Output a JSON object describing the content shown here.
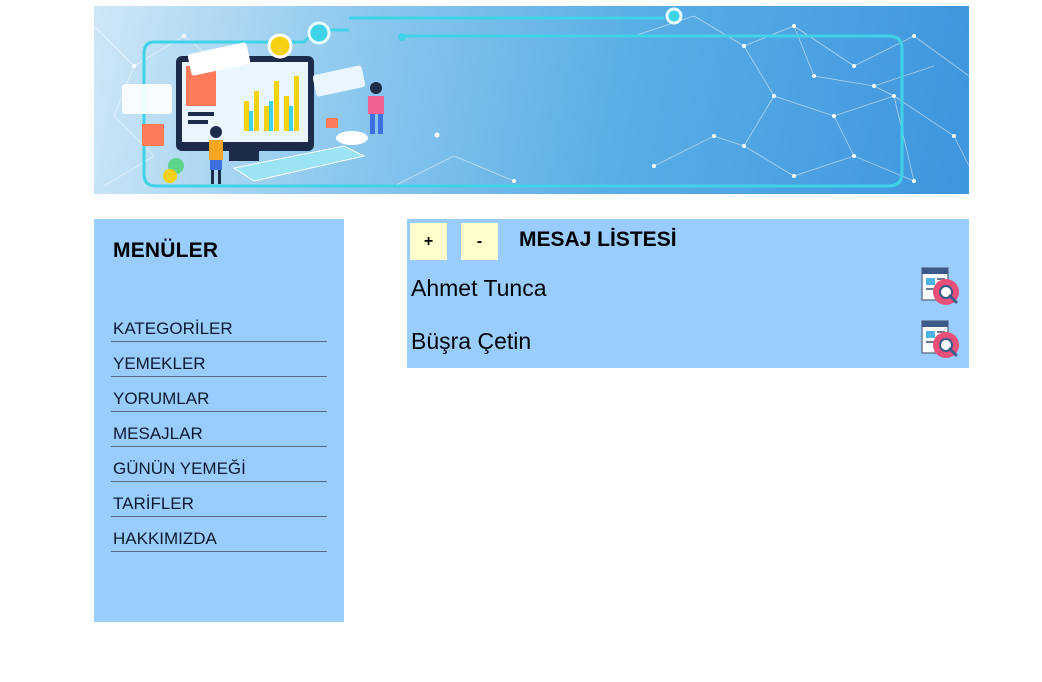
{
  "banner": {
    "image_name": "technology-banner-illustration"
  },
  "sidebar": {
    "title": "MENÜLER",
    "items": [
      {
        "label": "KATEGORİLER"
      },
      {
        "label": "YEMEKLER"
      },
      {
        "label": "YORUMLAR"
      },
      {
        "label": "MESAJLAR"
      },
      {
        "label": "GÜNÜN YEMEĞİ"
      },
      {
        "label": "TARİFLER"
      },
      {
        "label": "HAKKIMIZDA"
      }
    ]
  },
  "main": {
    "add_label": "+",
    "remove_label": "-",
    "title": "MESAJ LİSTESİ",
    "messages": [
      {
        "name": "Ahmet Tunca",
        "icon": "view-details-icon"
      },
      {
        "name": "Büşra Çetin",
        "icon": "view-details-icon"
      }
    ]
  },
  "colors": {
    "panel_bg": "#99ccff",
    "button_bg": "#ffffcc",
    "icon_accent": "#e8507a"
  }
}
